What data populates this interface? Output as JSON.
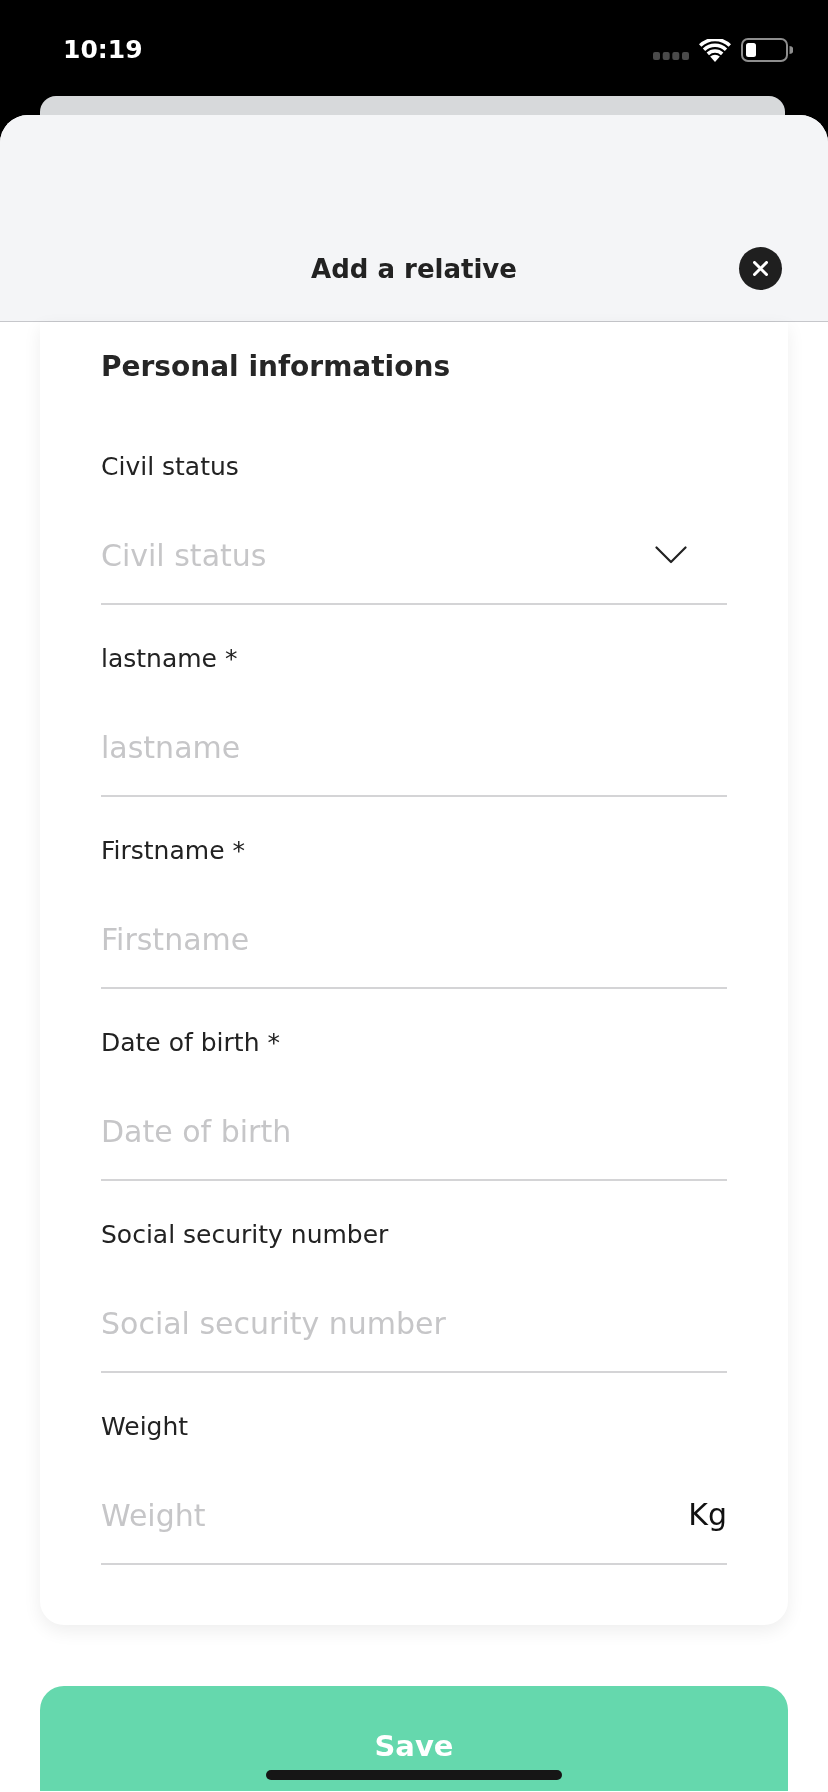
{
  "status_bar": {
    "time": "10:19"
  },
  "header": {
    "title": "Add a relative"
  },
  "section": {
    "title": "Personal informations",
    "fields": [
      {
        "kind": "select",
        "label": "Civil status",
        "placeholder": "Civil status"
      },
      {
        "kind": "text",
        "label": "lastname *",
        "placeholder": "lastname"
      },
      {
        "kind": "text",
        "label": "Firstname *",
        "placeholder": "Firstname"
      },
      {
        "kind": "text",
        "label": "Date of birth *",
        "placeholder": "Date of birth"
      },
      {
        "kind": "text",
        "label": "Social security number",
        "placeholder": "Social security number"
      },
      {
        "kind": "text",
        "label": "Weight",
        "placeholder": "Weight",
        "unit": "Kg"
      }
    ]
  },
  "save_button": {
    "label": "Save"
  }
}
